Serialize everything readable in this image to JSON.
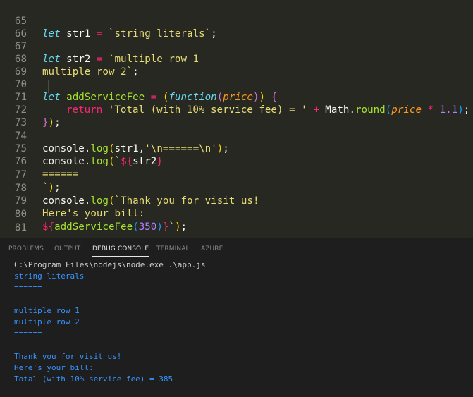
{
  "editor": {
    "line_numbers": [
      "65",
      "66",
      "67",
      "68",
      "69",
      "70",
      "71",
      "72",
      "73",
      "74",
      "75",
      "76",
      "77",
      "78",
      "79",
      "80",
      "81"
    ],
    "tokens": {
      "l65_let": "let",
      "l65_name": " str1 ",
      "l65_eq": "=",
      "l65_str": " `string literals`",
      "l65_semi": ";",
      "l67_let": "let",
      "l67_name": " str2 ",
      "l67_eq": "=",
      "l67_str": " `multiple row 1",
      "l68_str": "multiple row 2`",
      "l68_semi": ";",
      "l70_let": "let",
      "l70_fn": " addServiceFee",
      "l70_eq": " = ",
      "l70_p1": "(",
      "l70_kw": "function",
      "l70_p2": "(",
      "l70_param": "price",
      "l70_p3": ")",
      "l70_p4": ")",
      "l70_sp": " ",
      "l70_brace": "{",
      "l71_ret": "return",
      "l71_str": " 'Total (with 10% service fee) = '",
      "l71_plus": " + ",
      "l71_math": "Math.",
      "l71_round": "round",
      "l71_p1": "(",
      "l71_param": "price",
      "l71_mul": " * ",
      "l71_num": "1.1",
      "l71_p2": ")",
      "l71_semi": ";",
      "l72_brace": "}",
      "l72_paren": ")",
      "l72_semi": ";",
      "l74_console": "console.",
      "l74_log": "log",
      "l74_p1": "(",
      "l74_arg": "str1,",
      "l74_str": "'\\n======\\n'",
      "l74_p2": ")",
      "l74_semi": ";",
      "l75_console": "console.",
      "l75_log": "log",
      "l75_p1": "(",
      "l75_tick": "`",
      "l75_interp": "${",
      "l75_var": "str2",
      "l75_close": "}",
      "l76_str": "======",
      "l77_tick": "`",
      "l77_p": ")",
      "l77_semi": ";",
      "l78_console": "console.",
      "l78_log": "log",
      "l78_p1": "(",
      "l78_str": "`Thank you for visit us!",
      "l79_str": "Here's your bill:",
      "l80_interp": "${",
      "l80_fn": "addServiceFee",
      "l80_p1": "(",
      "l80_num": "350",
      "l80_p2": ")",
      "l80_close": "}",
      "l80_tick": "`",
      "l80_p3": ")",
      "l80_semi": ";"
    }
  },
  "panel": {
    "tabs": [
      "PROBLEMS",
      "OUTPUT",
      "DEBUG CONSOLE",
      "TERMINAL",
      "AZURE"
    ],
    "active_tab": "DEBUG CONSOLE",
    "output": [
      "C:\\Program Files\\nodejs\\node.exe .\\app.js",
      "string literals",
      "======",
      "",
      "multiple row 1",
      "multiple row 2",
      "======",
      "",
      "Thank you for visit us!",
      "Here's your bill:",
      "Total (with 10% service fee) = 385"
    ]
  },
  "colors": {
    "editor_bg": "#272822",
    "panel_bg": "#1e1e1e",
    "keyword": "#66d9ef",
    "string": "#e6db74",
    "operator": "#f92672",
    "function": "#a6e22e",
    "param": "#fd971f",
    "number": "#ae81ff",
    "console_output": "#3794ff"
  }
}
